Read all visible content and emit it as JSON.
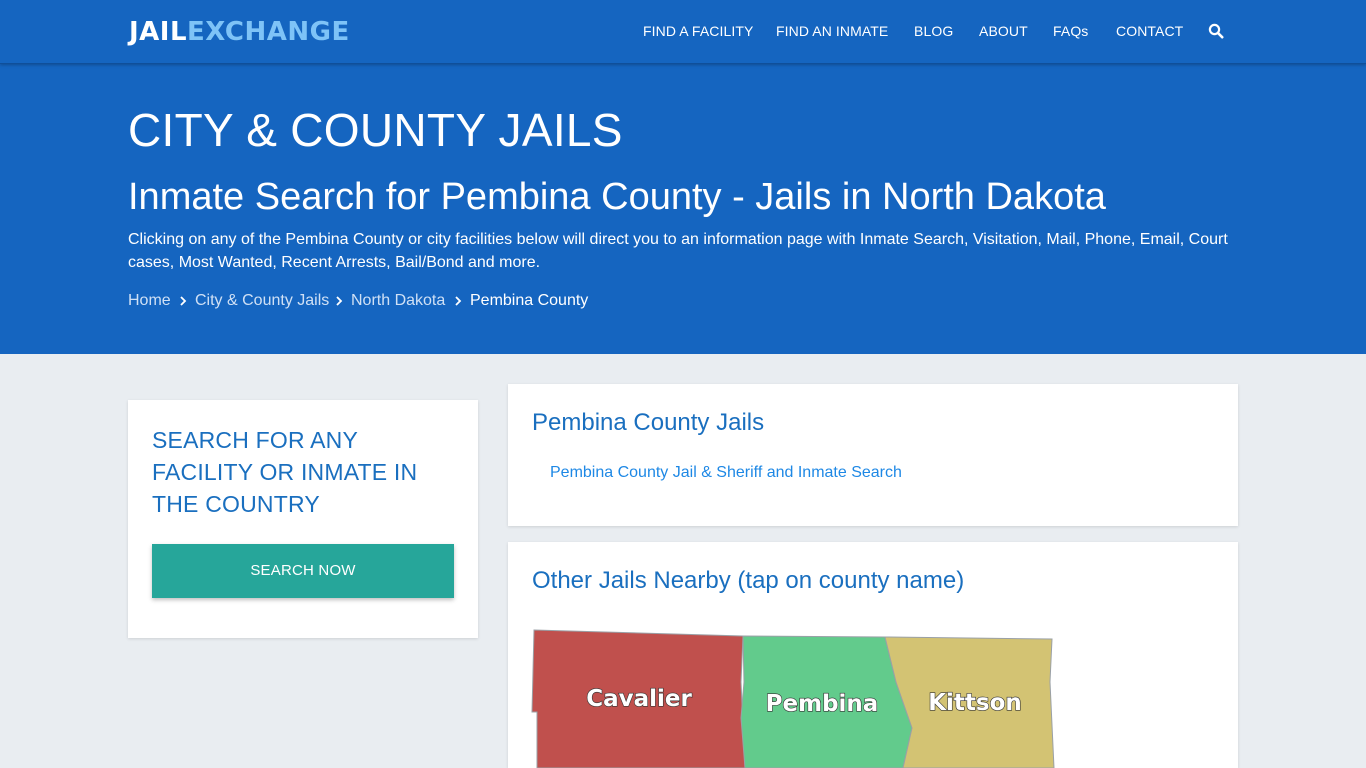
{
  "logo": {
    "part1": "JAIL",
    "part2": "EXCHANGE"
  },
  "nav": {
    "items": [
      "FIND A FACILITY",
      "FIND AN INMATE",
      "BLOG",
      "ABOUT",
      "FAQs",
      "CONTACT"
    ],
    "search_icon": "search-icon"
  },
  "hero": {
    "title": "CITY & COUNTY JAILS",
    "subtitle": "Inmate Search for Pembina County - Jails in North Dakota",
    "description": "Clicking on any of the Pembina County or city facilities below will direct you to an information page with Inmate Search, Visitation, Mail, Phone, Email, Court cases, Most Wanted, Recent Arrests, Bail/Bond and more.",
    "breadcrumbs": [
      "Home",
      "City & County Jails",
      "North Dakota",
      "Pembina County"
    ]
  },
  "sidebar": {
    "heading": "SEARCH FOR ANY FACILITY OR INMATE IN THE COUNTRY",
    "button": "SEARCH NOW"
  },
  "jails": {
    "heading": "Pembina County Jails",
    "links": [
      "Pembina County Jail & Sheriff and Inmate Search"
    ]
  },
  "nearby": {
    "heading": "Other Jails Nearby (tap on county name)",
    "counties": [
      {
        "name": "Cavalier",
        "color": "#c0504d"
      },
      {
        "name": "Pembina",
        "color": "#62cb8c"
      },
      {
        "name": "Kittson",
        "color": "#d3c373"
      }
    ]
  },
  "colors": {
    "brand_blue": "#1565c0",
    "accent_teal": "#26a69a",
    "link_blue": "#1e88e5",
    "heading_blue": "#1a6fbf",
    "page_bg": "#e9edf1"
  }
}
